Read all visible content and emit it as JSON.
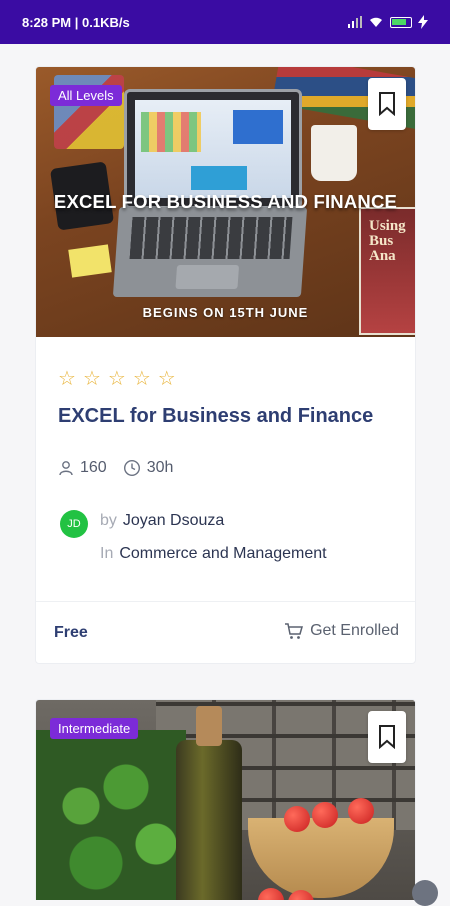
{
  "status_bar": {
    "time": "8:28 PM | 0.1KB/s",
    "icons": [
      "signal-icon",
      "wifi-icon",
      "battery-icon",
      "charging-icon"
    ]
  },
  "courses": [
    {
      "level": "All Levels",
      "thumbnail_title": "EXCEL FOR BUSINESS AND FINANCE",
      "thumbnail_subtitle": "BEGINS ON 15TH JUNE",
      "thumbnail_book_text": "Using Bus Ana",
      "rating": 0,
      "rating_max": 5,
      "title": "EXCEL for Business and Finance",
      "students": "160",
      "duration": "30h",
      "author_initials": "JD",
      "author_prefix": "by",
      "author_name": "Joyan Dsouza",
      "category_prefix": "In",
      "category": "Commerce and Management",
      "price": "Free",
      "enroll_label": "Get Enrolled"
    },
    {
      "level": "Intermediate"
    }
  ],
  "colors": {
    "status_bar": "#3a0ca3",
    "badge": "#7c2bd8",
    "title": "#2e3e72",
    "star": "#e9b53c",
    "avatar": "#22c243"
  }
}
